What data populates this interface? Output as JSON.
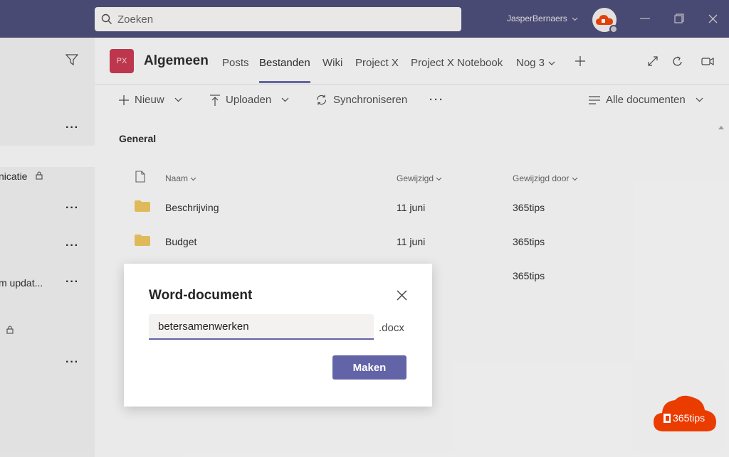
{
  "titlebar": {
    "search_placeholder": "Zoeken",
    "user_name": "JasperBernaers"
  },
  "left_panel": {
    "items": [
      {
        "label": "nicatie"
      },
      {
        "label": "m updat..."
      }
    ]
  },
  "channel": {
    "team_initials": "PX",
    "name": "Algemeen",
    "tabs": [
      {
        "label": "Posts"
      },
      {
        "label": "Bestanden"
      },
      {
        "label": "Wiki"
      },
      {
        "label": "Project X"
      },
      {
        "label": "Project X Notebook"
      },
      {
        "label": "Nog 3"
      }
    ]
  },
  "toolbar": {
    "new_label": "Nieuw",
    "upload_label": "Uploaden",
    "sync_label": "Synchroniseren",
    "view_label": "Alle documenten"
  },
  "files": {
    "section_title": "General",
    "columns": {
      "name": "Naam",
      "modified": "Gewijzigd",
      "modified_by": "Gewijzigd door"
    },
    "rows": [
      {
        "name": "Beschrijving",
        "modified": "11 juni",
        "modified_by": "365tips"
      },
      {
        "name": "Budget",
        "modified": "11 juni",
        "modified_by": "365tips"
      },
      {
        "name": "",
        "modified": "",
        "modified_by": "365tips"
      }
    ]
  },
  "dialog": {
    "title": "Word-document",
    "input_value": "betersamenwerken",
    "extension": ".docx",
    "create_label": "Maken"
  },
  "watermark": {
    "text": "365tips"
  },
  "colors": {
    "titlebar": "#464775",
    "accent": "#6264a7",
    "team_tile": "#c4314b",
    "folder": "#e8c15a",
    "watermark": "#eb3c00"
  }
}
